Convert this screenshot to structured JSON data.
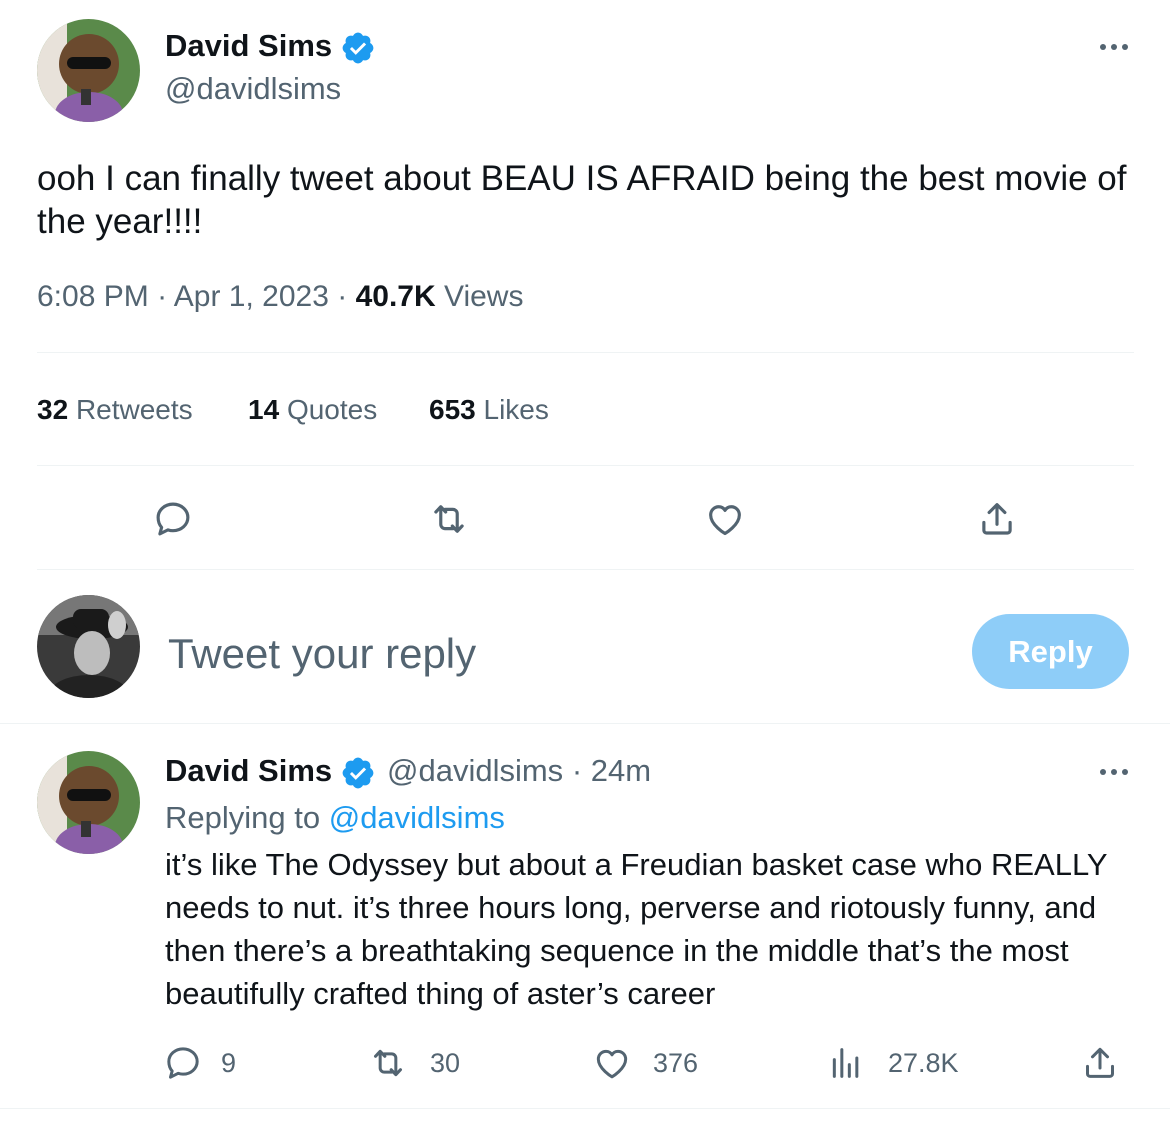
{
  "main_tweet": {
    "author": {
      "name": "David Sims",
      "handle": "@davidlsims"
    },
    "text": "ooh I can finally tweet about BEAU IS AFRAID being the best movie of the year!!!!",
    "time": "6:08 PM",
    "separator": "·",
    "date": "Apr 1, 2023",
    "views_count": "40.7K",
    "views_label": "Views",
    "stats": {
      "retweets_count": "32",
      "retweets_label": "Retweets",
      "quotes_count": "14",
      "quotes_label": "Quotes",
      "likes_count": "653",
      "likes_label": "Likes"
    }
  },
  "composer": {
    "placeholder": "Tweet your reply",
    "button_label": "Reply"
  },
  "reply_tweet": {
    "author": {
      "name": "David Sims",
      "handle": "@davidlsims"
    },
    "time_ago": "· 24m",
    "replying_prefix": "Replying to",
    "replying_handle": "@davidlsims",
    "text": "it’s like The Odyssey but about a Freudian basket case who REALLY needs to nut. it’s three hours long, perverse and riotously funny, and then there’s a breathtaking sequence in the middle that’s the most beautifully crafted thing of aster’s career",
    "counts": {
      "replies": "9",
      "retweets": "30",
      "likes": "376",
      "views": "27.8K"
    }
  },
  "colors": {
    "accent": "#1d9bf0",
    "reply_button": "#8ecdf8",
    "secondary_text": "#536471",
    "primary_text": "#0f1419",
    "divider": "#eff3f4"
  },
  "icons": {
    "verified": "verified-badge-icon",
    "more": "more-dots-icon",
    "reply": "reply-icon",
    "retweet": "retweet-icon",
    "like": "heart-icon",
    "share": "share-icon",
    "views": "views-chart-icon"
  }
}
